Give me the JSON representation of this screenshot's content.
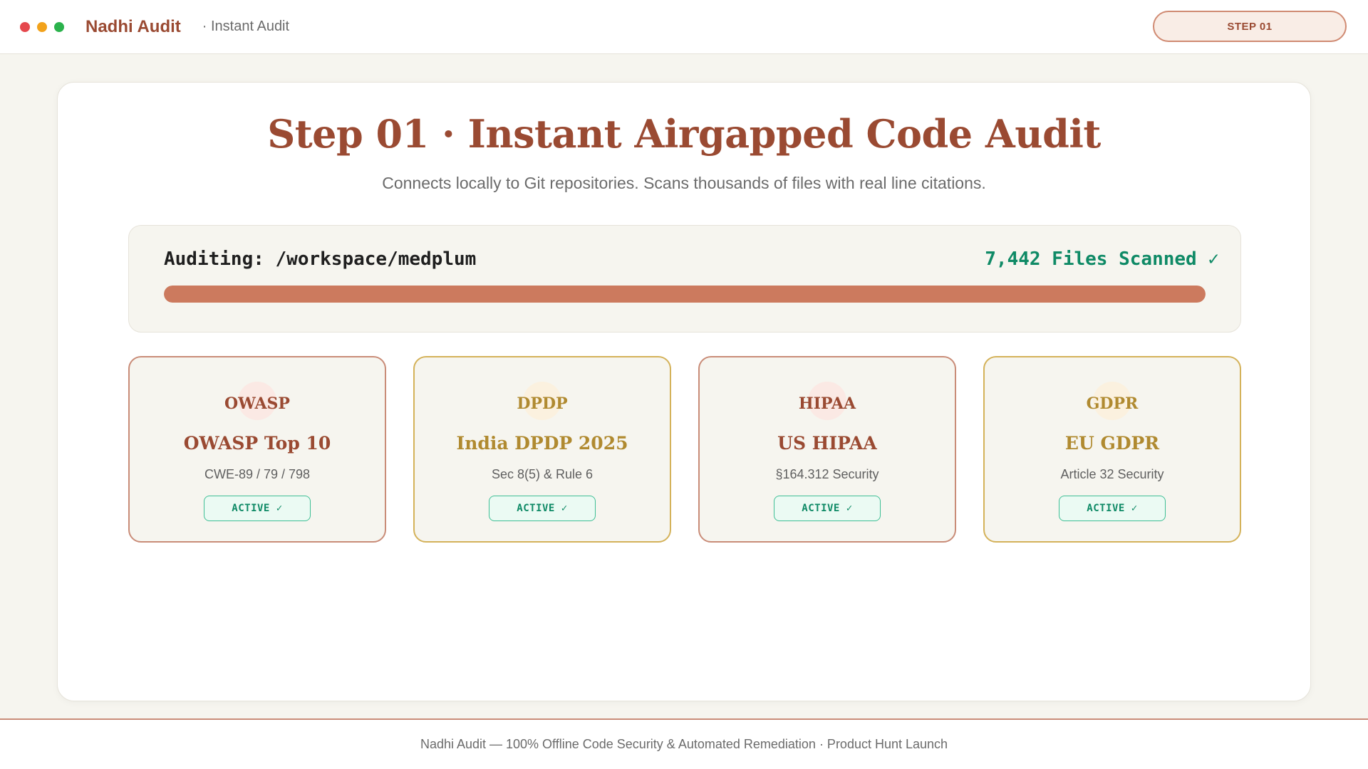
{
  "window": {
    "controls": [
      "close-icon",
      "minimize-icon",
      "zoom-icon"
    ]
  },
  "header": {
    "brand": "Nadhi Audit",
    "breadcrumb": "· Instant Audit",
    "step_badge": "STEP 01"
  },
  "main": {
    "title": "Step 01 · Instant Airgapped Code Audit",
    "subtitle": "Connects locally to Git repositories. Scans thousands of files with real line citations.",
    "audit": {
      "path_label": "Auditing: /workspace/medplum",
      "files_scanned": "7,442 Files Scanned ✓",
      "progress_fraction": 1.0
    },
    "frameworks": [
      {
        "code": "OWASP",
        "name": "OWASP Top 10",
        "reference": "CWE-89 / 79 / 798",
        "status": "ACTIVE ✓",
        "accent": "#9a4a32"
      },
      {
        "code": "DPDP",
        "name": "India DPDP 2025",
        "reference": "Sec 8(5) & Rule 6",
        "status": "ACTIVE ✓",
        "accent": "#b08a30"
      },
      {
        "code": "HIPAA",
        "name": "US HIPAA",
        "reference": "§164.312 Security",
        "status": "ACTIVE ✓",
        "accent": "#9a4a32"
      },
      {
        "code": "GDPR",
        "name": "EU GDPR",
        "reference": "Article 32 Security",
        "status": "ACTIVE ✓",
        "accent": "#b08a30"
      }
    ]
  },
  "footer": {
    "text": "Nadhi Audit — 100% Offline Code Security & Automated Remediation · Product Hunt Launch"
  },
  "colors": {
    "brand": "#9a4a32",
    "gold": "#b08a30",
    "success": "#0f8a66",
    "progress": "#cc7a5e",
    "background": "#f6f5ef"
  }
}
